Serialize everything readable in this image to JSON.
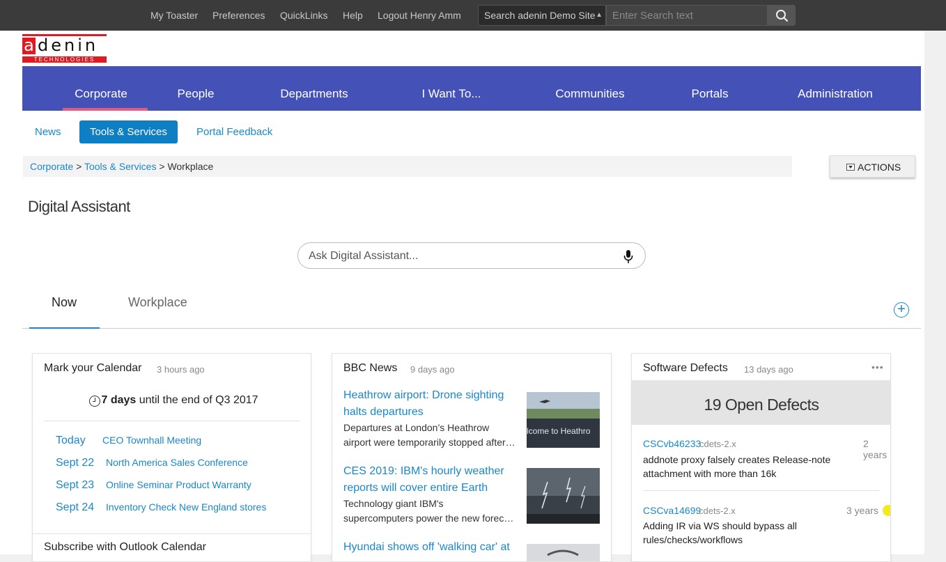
{
  "topbar": {
    "links": [
      "My Toaster",
      "Preferences",
      "QuickLinks",
      "Help",
      "Logout Henry Amm"
    ],
    "search_scope": "Search adenin Demo Site",
    "search_placeholder": "Enter Search text"
  },
  "logo": {
    "letter": "a",
    "rest": "denin",
    "sub": "TECHNOLOGIES"
  },
  "mainnav": {
    "items": [
      "Corporate",
      "People",
      "Departments",
      "I Want To...",
      "Communities",
      "Portals",
      "Administration"
    ],
    "active": "Corporate"
  },
  "subnav": {
    "items": [
      "News",
      "Tools & Services",
      "Portal Feedback"
    ],
    "active": "Tools & Services"
  },
  "breadcrumb": {
    "items": [
      "Corporate",
      "Tools & Services"
    ],
    "separator": ">",
    "current": "Workplace"
  },
  "actions_label": "ACTIONS",
  "page_title": "Digital Assistant",
  "assistant": {
    "placeholder": "Ask Digital Assistant..."
  },
  "tabs": {
    "items": [
      "Now",
      "Workplace"
    ],
    "active": "Now",
    "add": "+"
  },
  "calendar": {
    "title": "Mark your Calendar",
    "age": "3 hours ago",
    "countdown_bold": "7 days",
    "countdown_rest": "until the end of Q3 2017",
    "events": [
      {
        "date": "Today",
        "name": "CEO Townhall Meeting"
      },
      {
        "date": "Sept 22",
        "name": "North America Sales Conference"
      },
      {
        "date": "Sept 23",
        "name": "Online Seminar Product Warranty"
      },
      {
        "date": "Sept 24",
        "name": "Inventory Check New England stores"
      }
    ],
    "subscribe": "Subscribe with Outlook Calendar"
  },
  "news": {
    "title": "BBC News",
    "age": "9 days ago",
    "items": [
      {
        "headline_1": "Heathrow airport: Drone sighting",
        "headline_2": "halts departures",
        "desc_1": "Departures at London’s Heathrow",
        "desc_2": "airport were temporarily stopped after…",
        "thumb_text": "lcome to Heathro"
      },
      {
        "headline_1": "CES 2019: IBM's hourly weather",
        "headline_2": "reports will cover entire Earth",
        "desc_1": "Technology giant IBM's",
        "desc_2": "supercomputers power the new forec…"
      },
      {
        "headline_1": "Hyundai shows off 'walking car' at"
      }
    ]
  },
  "defects": {
    "title": "Software Defects",
    "age": "13 days ago",
    "menu": "•••",
    "close": "✕",
    "banner": "19 Open Defects",
    "items": [
      {
        "id": "CSCvb46233",
        "tag": "cdets-2.x",
        "age": "2 years",
        "text_1": "addnote proxy falsely creates Release-note",
        "text_2": "attachment with more than 16k"
      },
      {
        "id": "CSCva14699",
        "tag": "cdets-2.x",
        "age": "3 years",
        "text_1": "Adding IR via WS should bypass all",
        "text_2": "rules/checks/workflows",
        "dot_color": "#f2ea1c"
      }
    ]
  },
  "colors": {
    "nav": "#4452b7",
    "accent": "#1a87c9",
    "active_underline": "#e8587b",
    "brand_red": "#e11a22"
  }
}
